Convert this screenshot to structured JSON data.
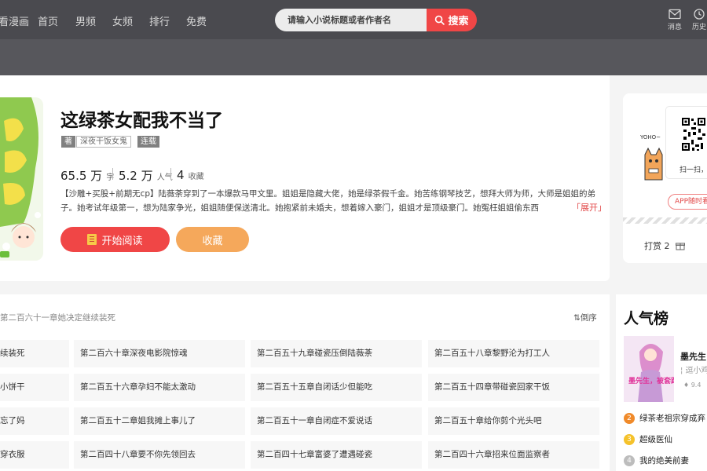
{
  "nav": {
    "items": [
      "看漫画",
      "首页",
      "男频",
      "女频",
      "排行",
      "免费"
    ],
    "search_placeholder": "请输入小说标题或者作者名",
    "search_button": "搜索",
    "messages": "消息",
    "history": "历史"
  },
  "book": {
    "title": "这绿茶女配我不当了",
    "author_role": "著",
    "author": "深夜干饭女鬼",
    "status": "连载",
    "stats": [
      {
        "num": "65.5 万",
        "unit": "字"
      },
      {
        "num": "5.2 万",
        "unit": "人气"
      },
      {
        "num": "4",
        "unit": "收藏"
      }
    ],
    "description": "【沙雕+买股+前期无cp】陆薇荼穿到了一本爆款马甲文里。姐姐是隐藏大佬，她是绿茶假千金。她苦练钢琴技艺，想拜大师为师，大师是姐姐的弟子。她考试年级第一，想为陆家争光，姐姐随便保送清北。她抱紧前未婚夫，想着嫁入豪门，姐姐才是顶级豪门。她冤枉姐姐偷东西",
    "expand": "「展开」",
    "read_button": "开始阅读",
    "collect_button": "收藏"
  },
  "app_panel": {
    "scan_label": "扫一扫，",
    "app_button": "APP随时看",
    "tip_label": "打赏 2",
    "mascot_text": "YOHO~"
  },
  "chapters": {
    "latest": "第二百六十一章她决定继续装死",
    "sort_label": "倒序",
    "rows": [
      [
        "续装死",
        "第二百六十章深夜电影院惊魂",
        "第二百五十九章碰瓷压倒陆薇荼",
        "第二百五十八章黎野沦为打工人"
      ],
      [
        "小饼干",
        "第二百五十六章孕妇不能太激动",
        "第二百五十五章自闭话少但能吃",
        "第二百五十四章带碰瓷回家干饭"
      ],
      [
        "忘了妈",
        "第二百五十二章姐我摊上事儿了",
        "第二百五十一章自闭症不爱说话",
        "第二百五十章给你剪个光头吧"
      ],
      [
        "穿衣服",
        "第二百四十八章要不你先领回去",
        "第二百四十七章富婆了遭遇碰瓷",
        "第二百四十六章招来位面监察者"
      ]
    ]
  },
  "ranking": {
    "title": "人气榜",
    "top_name": "墨先生",
    "top_author": "逗小鸡",
    "top_score": "9.4",
    "cover_text": "墨先生，被套路的",
    "items": [
      {
        "rank": "2",
        "name": "绿茶老祖宗穿成弃",
        "color": "#f08a2a"
      },
      {
        "rank": "3",
        "name": "超级医仙",
        "color": "#f5c22b"
      },
      {
        "rank": "4",
        "name": "我的绝美前妻",
        "color": "#bdbdbd"
      }
    ]
  },
  "colors": {
    "accent": "#f04646",
    "collect": "#f5a85b",
    "topbar": "#4a4a4f"
  }
}
